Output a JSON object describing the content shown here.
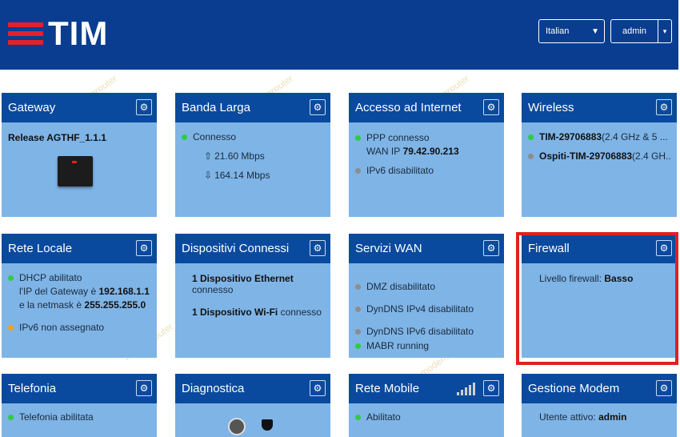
{
  "header": {
    "logo_text": "TIM",
    "language": "Italian",
    "user": "admin"
  },
  "cards": {
    "gateway": {
      "title": "Gateway",
      "release": "Release AGTHF_1.1.1"
    },
    "banda": {
      "title": "Banda Larga",
      "status": "Connesso",
      "up": "21.60 Mbps",
      "down": "164.14 Mbps"
    },
    "internet": {
      "title": "Accesso ad Internet",
      "ppp": "PPP connesso",
      "wan_prefix": "WAN IP",
      "wan_ip": "79.42.90.213",
      "ipv6": "IPv6 disabilitato"
    },
    "wireless": {
      "title": "Wireless",
      "ssid1": "TIM-29706883",
      "ssid1_suffix": "(2.4 GHz & 5 ...",
      "ssid2": "Ospiti-TIM-29706883",
      "ssid2_suffix": "(2.4 GH..."
    },
    "rete_locale": {
      "title": "Rete Locale",
      "dhcp": "DHCP abilitato",
      "gw_prefix": "l'IP del Gateway è",
      "gw_ip": "192.168.1.1",
      "mask_prefix": "e la netmask è",
      "mask": "255.255.255.0",
      "ipv6": "IPv6 non assegnato"
    },
    "dispositivi": {
      "title": "Dispositivi Connessi",
      "eth_bold": "1 Dispositivo Ethernet",
      "eth_rest": "connesso",
      "wifi_bold": "1 Dispositivo Wi-Fi",
      "wifi_rest": "connesso"
    },
    "servizi_wan": {
      "title": "Servizi WAN",
      "dmz": "DMZ disabilitato",
      "dyn4": "DynDNS IPv4 disabilitato",
      "dyn6": "DynDNS IPv6 disabilitato",
      "mabr": "MABR running"
    },
    "firewall": {
      "title": "Firewall",
      "level_prefix": "Livello firewall:",
      "level": "Basso"
    },
    "telefonia": {
      "title": "Telefonia",
      "status": "Telefonia abilitata"
    },
    "diagnostica": {
      "title": "Diagnostica"
    },
    "rete_mobile": {
      "title": "Rete Mobile",
      "status": "Abilitato"
    },
    "gestione": {
      "title": "Gestione Modem",
      "user_prefix": "Utente attivo:",
      "user": "admin"
    }
  },
  "colors": {
    "header": "#0a3d8f",
    "card_title": "#0a4a9e",
    "card_body": "#7fb4e7",
    "status_ok": "#2ecc40",
    "status_off": "#8d8d8d",
    "status_warn": "#f0a020",
    "highlight": "#e02020"
  }
}
